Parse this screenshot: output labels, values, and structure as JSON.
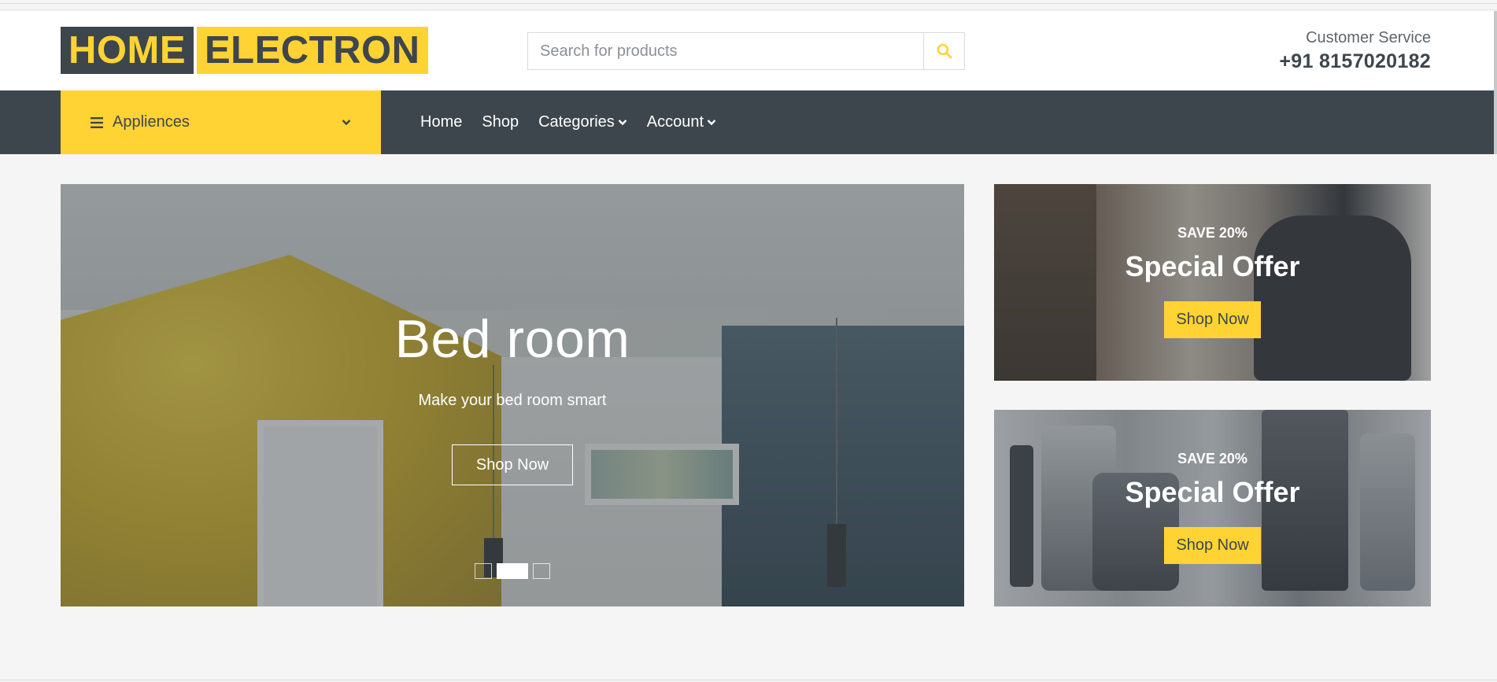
{
  "brand": {
    "part1": "HOME",
    "part2": "ELECTRON"
  },
  "search": {
    "placeholder": "Search for products",
    "icon": "search-icon"
  },
  "customer_service": {
    "label": "Customer Service",
    "phone": "+91 8157020182"
  },
  "nav": {
    "category_toggle": "Appliences",
    "links": [
      {
        "label": "Home",
        "dropdown": false
      },
      {
        "label": "Shop",
        "dropdown": false
      },
      {
        "label": "Categories",
        "dropdown": true
      },
      {
        "label": "Account",
        "dropdown": true
      }
    ]
  },
  "hero": {
    "title": "Bed room",
    "subtitle": "Make your bed room smart",
    "button": "Shop Now",
    "active_slide": 2,
    "slide_count": 3
  },
  "offers": [
    {
      "save": "SAVE 20%",
      "title": "Special Offer",
      "button": "Shop Now"
    },
    {
      "save": "SAVE 20%",
      "title": "Special Offer",
      "button": "Shop Now"
    }
  ],
  "colors": {
    "accent": "#ffd333",
    "dark": "#3d464d",
    "background": "#f5f5f5"
  }
}
